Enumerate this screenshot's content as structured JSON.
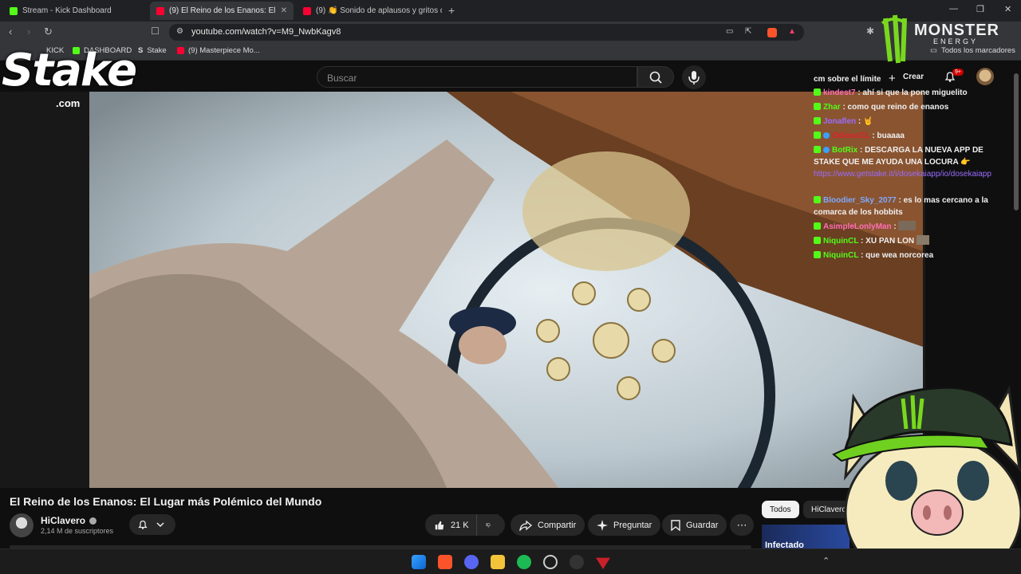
{
  "browser": {
    "tabs": [
      {
        "label": "Stream - Kick Dashboard",
        "active": false
      },
      {
        "label": "(9) El Reino de los Enanos: El",
        "active": true
      },
      {
        "label": "(9) 👏 Sonido de aplausos y gritos d",
        "active": false
      }
    ],
    "url": "youtube.com/watch?v=M9_NwbKagv8",
    "bookmarks": [
      "KICK",
      "DASHBOARD",
      "Stake",
      "(9) Masterpiece Mo..."
    ],
    "all_bookmarks": "Todos los marcadores"
  },
  "youtube": {
    "search_placeholder": "Buscar",
    "create_label": "Crear",
    "notif_count": "9+",
    "video_title": "El Reino de los Enanos: El Lugar más Polémico del Mundo",
    "channel_name": "HiClavero",
    "subscribers": "2,14 M de suscriptores",
    "likes": "21 K",
    "share_label": "Compartir",
    "ask_label": "Preguntar",
    "save_label": "Guardar",
    "chips": [
      "Todos",
      "HiClavero"
    ],
    "side_thumb_text": "Infectado"
  },
  "overlay": {
    "stake_logo": "Stake",
    "stake_domain": ".com",
    "monster_brand": "MONSTER",
    "monster_sub": "ENERGY"
  },
  "chat": {
    "header": "cm sobre el límite",
    "messages": [
      {
        "user": "kindest7",
        "text": ": ahí si que la pone miguelito",
        "color": "#ff6fb5"
      },
      {
        "user": "Zhar",
        "text": ": como que reino de enanos",
        "color": "#53fc18"
      },
      {
        "user": "Jonaflen",
        "text": ": 🤘",
        "color": "#9a6cff"
      },
      {
        "user": "OdiosoCL",
        "text": ": buaaaa",
        "color": "#e0202a"
      },
      {
        "user": "BotRix",
        "text": ": DESCARGA LA NUEVA APP DE STAKE QUE ME AYUDA UNA LOCURA 👉",
        "color": "#53fc18",
        "link": "https://www.getstake.it/i/dosekaiapp/io/dosekaiapp"
      },
      {
        "user": "Bloodier_Sky_2077",
        "text": ": es lo mas cercano a la comarca de los hobbits",
        "color": "#7da9ff"
      },
      {
        "user": "AsimpleLonlyMan",
        "text": ":",
        "color": "#ff6fb5"
      },
      {
        "user": "NiquinCL",
        "text": ": XU PAN LON",
        "color": "#53fc18"
      },
      {
        "user": "NiquinCL",
        "text": ": que wea norcorea",
        "color": "#53fc18"
      }
    ]
  }
}
